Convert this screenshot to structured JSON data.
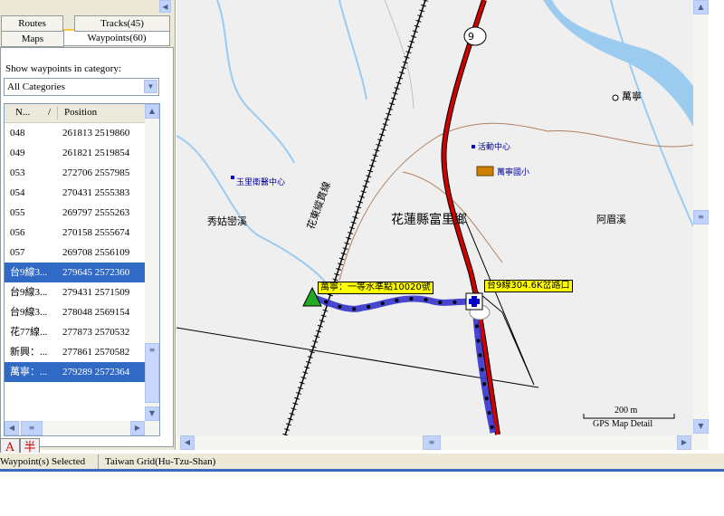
{
  "tabs": {
    "row1": [
      "Routes",
      "Tracks(45)"
    ],
    "row2": [
      "Maps",
      "Waypoints(60)"
    ],
    "active": "Waypoints(60)"
  },
  "waypoints_panel": {
    "category_label": "Show waypoints in category:",
    "category_value": "All Categories",
    "columns": [
      "N...",
      "Position"
    ],
    "sort_indicator": "/",
    "rows": [
      {
        "name": "048",
        "position": "261813 2519860",
        "selected": false
      },
      {
        "name": "049",
        "position": "261821 2519854",
        "selected": false
      },
      {
        "name": "053",
        "position": "272706 2557985",
        "selected": false
      },
      {
        "name": "054",
        "position": "270431 2555383",
        "selected": false
      },
      {
        "name": "055",
        "position": "269797 2555263",
        "selected": false
      },
      {
        "name": "056",
        "position": "270158 2555674",
        "selected": false
      },
      {
        "name": "057",
        "position": "269708 2556109",
        "selected": false
      },
      {
        "name": "台9線3...",
        "position": "279645 2572360",
        "selected": true
      },
      {
        "name": "台9線3...",
        "position": "279431 2571509",
        "selected": false
      },
      {
        "name": "台9線3...",
        "position": "278048 2569154",
        "selected": false
      },
      {
        "name": "花77線...",
        "position": "277873 2570532",
        "selected": false
      },
      {
        "name": "新興：...",
        "position": "277861 2570582",
        "selected": false
      },
      {
        "name": "萬寧：...",
        "position": "279289 2572364",
        "selected": true
      }
    ]
  },
  "ime": {
    "a": "A",
    "b": "半"
  },
  "map": {
    "road_marker": "9",
    "labels": {
      "township": "花蓮縣富里鄉",
      "railway": "花東縱貫線",
      "wanning": "萬寧",
      "xiugu_creek": "秀姑巒溪",
      "amei_creek": "阿眉溪"
    },
    "pois": {
      "activity_center": "活動中心",
      "wanning_school": "萬寧國小",
      "yuli_center": "玉里衛醫中心"
    },
    "waypoint_labels": {
      "wanning_point": "萬寧：一等水準點10020號",
      "tai9_point": "台9線304.6K岔路口"
    },
    "scale": {
      "distance": "200 m",
      "detail": "GPS Map Detail"
    }
  },
  "status": {
    "selected": "Waypoint(s) Selected",
    "grid": "Taiwan Grid(Hu-Tzu-Shan)"
  },
  "colors": {
    "selection": "#316ac5",
    "road": "#d00000",
    "track": "#4444ee",
    "river": "#9ccbf0"
  }
}
